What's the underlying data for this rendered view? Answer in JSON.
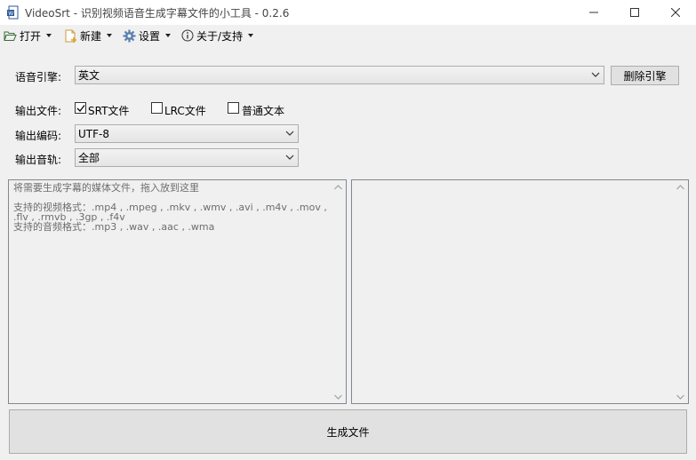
{
  "window": {
    "title": "VideoSrt - 识别视频语音生成字幕文件的小工具 - 0.2.6"
  },
  "menu": [
    {
      "label": "打开",
      "icon": "folder-open-icon"
    },
    {
      "label": "新建",
      "icon": "new-file-icon"
    },
    {
      "label": "设置",
      "icon": "gear-icon"
    },
    {
      "label": "关于/支持",
      "icon": "info-icon"
    }
  ],
  "engine": {
    "label": "语音引擎:",
    "selected": "英文",
    "delete_button": "删除引擎"
  },
  "output_files": {
    "label": "输出文件:",
    "options": [
      {
        "label": "SRT文件",
        "checked": true
      },
      {
        "label": "LRC文件",
        "checked": false
      },
      {
        "label": "普通文本",
        "checked": false
      }
    ]
  },
  "encoding": {
    "label": "输出编码:",
    "selected": "UTF-8"
  },
  "track": {
    "label": "输出音轨:",
    "selected": "全部"
  },
  "drop_area": {
    "text": "将需要生成字幕的媒体文件，拖入放到这里\n\n支持的视频格式：.mp4 , .mpeg , .mkv , .wmv , .avi , .m4v , .mov , .flv , .rmvb , .3gp , .f4v\n支持的音频格式：.mp3 , .wav , .aac , .wma"
  },
  "log_area": {
    "text": ""
  },
  "generate_button": "生成文件",
  "colors": {
    "background": "#f0f0f0",
    "titlebar": "#ffffff",
    "border": "#adadad",
    "hint_text": "#6d6d6d"
  }
}
